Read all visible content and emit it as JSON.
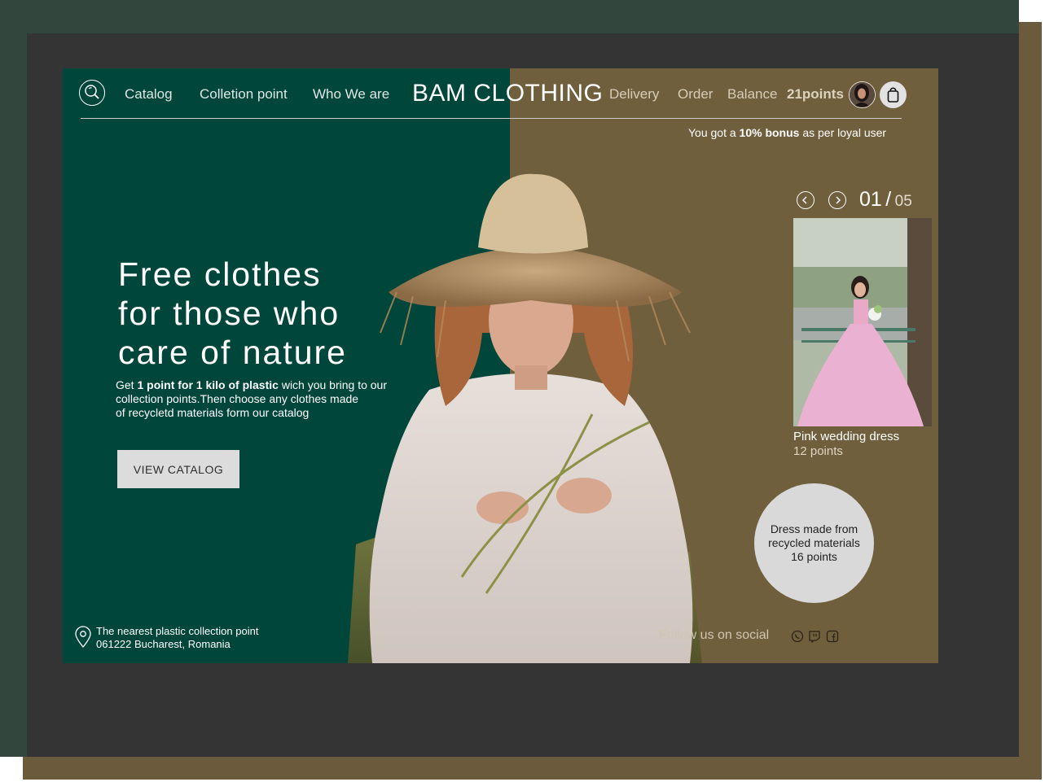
{
  "nav": {
    "left_links": [
      "Catalog",
      "Colletion point",
      "Who We are"
    ],
    "brand": "BAM CLOTHING",
    "right_links": [
      "Delivery",
      "Order",
      "Balance"
    ],
    "points": "21points"
  },
  "bonus": {
    "prefix": "You got a ",
    "highlight": "10% bonus",
    "suffix": " as per loyal user"
  },
  "hero": {
    "headline_lines": [
      "Free clothes",
      "for those who",
      "care of nature"
    ],
    "desc_prefix": "Get ",
    "desc_highlight": "1 point for 1 kilo of plastic",
    "desc_line1_rest": " wich you bring to our",
    "desc_line2": "collection points.Then choose any clothes made",
    "desc_line3": "of recycletd materials form our catalog",
    "cta_label": "VIEW CATALOG"
  },
  "location": {
    "line1": "The nearest plastic collection point",
    "line2": "061222 Bucharest, Romania"
  },
  "carousel": {
    "current": "01",
    "separator": "/",
    "total": "05",
    "item_title": "Pink wedding dress",
    "item_points": "12 points"
  },
  "bubble": {
    "line1": "Dress made from",
    "line2": "recycled materials",
    "line3": "16 points"
  },
  "social": {
    "label": "Follow us on social",
    "icons": [
      "whatsapp-icon",
      "twitch-icon",
      "facebook-icon"
    ]
  },
  "colors": {
    "hero_green": "#00463a",
    "hero_brown": "#705f3d",
    "frame_green": "#33463d",
    "frame_dark": "#343434"
  }
}
